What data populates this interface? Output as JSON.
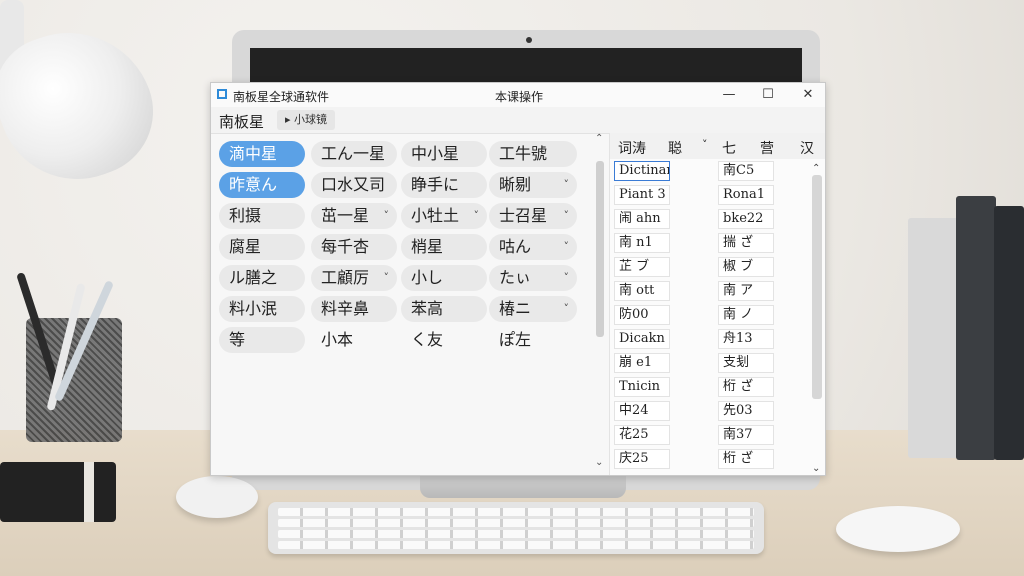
{
  "window": {
    "title": "南板星全球通软件",
    "center_title": "本课操作",
    "minimize_icon": "minimize-icon",
    "maximize_icon": "maximize-icon",
    "close_icon": "close-icon"
  },
  "toolbar": {
    "title": "南板星",
    "tab_label": "▸ 小球镜"
  },
  "chips": [
    {
      "label": "滴中星",
      "selected": true
    },
    {
      "label": "工ん一星",
      "selected": false
    },
    {
      "label": "中小星",
      "selected": false
    },
    {
      "label": "工牛號",
      "selected": false
    },
    {
      "label": "昨意ん",
      "selected": true
    },
    {
      "label": "口水又司",
      "selected": false
    },
    {
      "label": "睁手に",
      "selected": false
    },
    {
      "label": "晰剔",
      "selected": false,
      "dropdown": true
    },
    {
      "label": "利摄",
      "selected": false
    },
    {
      "label": "茁一星",
      "selected": false,
      "dropdown": true
    },
    {
      "label": "小牡土",
      "selected": false,
      "dropdown": true
    },
    {
      "label": "士召星",
      "selected": false,
      "dropdown": true
    },
    {
      "label": "腐星",
      "selected": false
    },
    {
      "label": "每千杏",
      "selected": false
    },
    {
      "label": "梢星",
      "selected": false
    },
    {
      "label": "咕ん",
      "selected": false,
      "dropdown": true
    },
    {
      "label": "ル膳之",
      "selected": false
    },
    {
      "label": "工顧厉",
      "selected": false,
      "dropdown": true
    },
    {
      "label": "小し",
      "selected": false
    },
    {
      "label": "たぃ",
      "selected": false,
      "dropdown": true
    },
    {
      "label": "料小泯",
      "selected": false
    },
    {
      "label": "料辛鼻",
      "selected": false
    },
    {
      "label": "苯高",
      "selected": false
    },
    {
      "label": "椿ニ",
      "selected": false,
      "dropdown": true
    },
    {
      "label": "等",
      "selected": false
    },
    {
      "label": "小本",
      "selected": false,
      "plain": true
    },
    {
      "label": "く友",
      "selected": false,
      "plain": true
    },
    {
      "label": "ぽ左",
      "selected": false,
      "plain": true
    }
  ],
  "right_panel": {
    "headers": [
      "词涛",
      "聪",
      "七",
      "营",
      "汉"
    ],
    "header_dropdown": "˅",
    "col1": [
      "Dictinary",
      "Piant 3",
      "闹 ahn",
      "南 n1",
      "芷 ブ",
      "南 ott",
      "防00",
      "Dicakn",
      "崩 e1",
      "Tnicin",
      "中24",
      "花25",
      "庆25"
    ],
    "col2": [
      "南C5",
      "Rona1",
      "bke22",
      "揣 ざ",
      "椒 ブ",
      "南 ア",
      "南 ノ",
      "舟13",
      "支刬",
      "桁 ざ",
      "先03",
      "南37",
      "桁 ざ"
    ]
  },
  "icons": {
    "app": "app-icon",
    "scroll_up": "scroll-up-icon",
    "scroll_down": "scroll-down-icon"
  }
}
